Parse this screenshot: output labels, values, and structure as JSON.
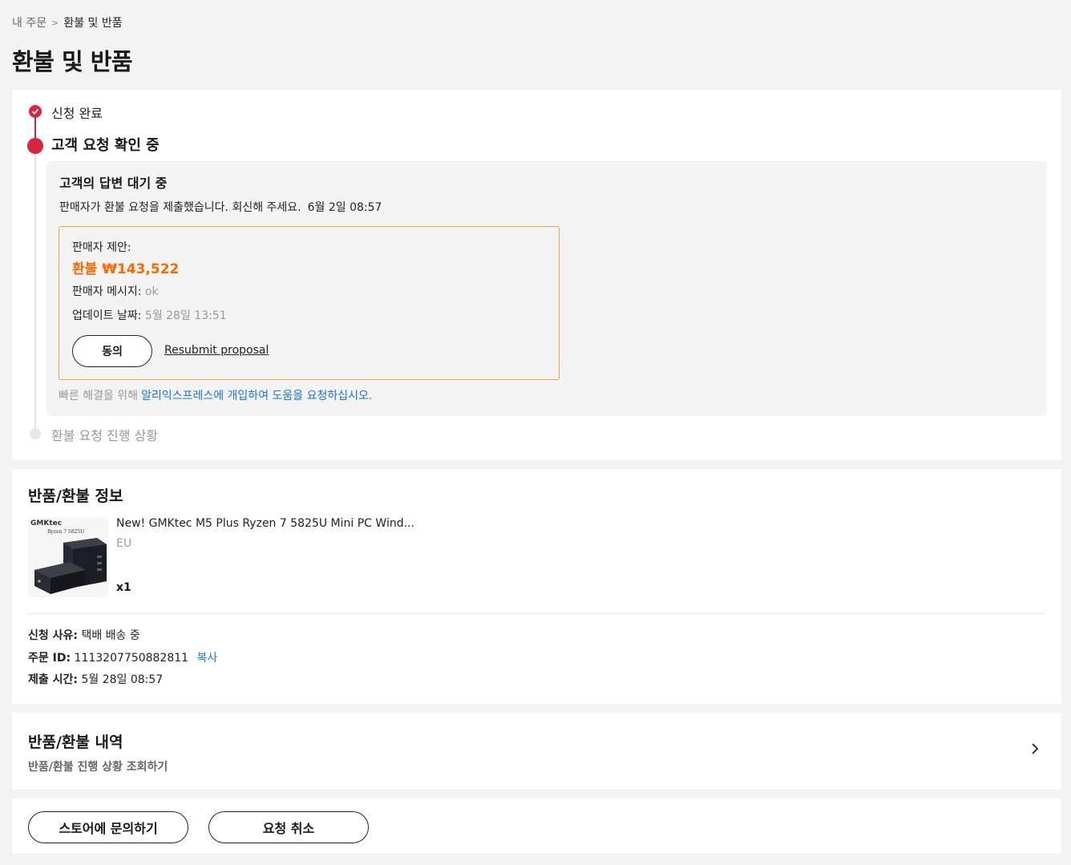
{
  "breadcrumb": {
    "parent": "내 주문",
    "separator": ">",
    "current": "환불 및 반품"
  },
  "page_title": "환불 및 반품",
  "timeline": {
    "step1": "신청 완료",
    "step2": "고객 요청 확인 중",
    "step3": "환불 요청 진행 상황"
  },
  "pending": {
    "title": "고객의 답변 대기 중",
    "message": "판매자가 환불 요청을 제출했습니다. 회신해 주세요.",
    "time": "6월 2일 08:57"
  },
  "proposal": {
    "label": "판매자 제안:",
    "amount": "환불 ₩143,522",
    "message_key": "판매자 메시지:",
    "message_value": "ok",
    "updated_key": "업데이트 날짜:",
    "updated_value": "5월 28일 13:51",
    "agree_label": "동의",
    "resubmit_label": "Resubmit proposal"
  },
  "help": {
    "prefix": "빠른 해결을 위해",
    "link": "알리익스프레스에 개입하여 도움을 요청하십시오."
  },
  "info": {
    "title": "반품/환불 정보",
    "thumb_brand": "GMKtec",
    "thumb_model": "Ryzen 7 5825U",
    "product_name": "New! GMKtec M5 Plus Ryzen 7 5825U Mini PC Wind...",
    "variant": "EU",
    "quantity": "x1",
    "reason_key": "신청 사유:",
    "reason_value": "택배 배송 중",
    "order_key": "주문 ID:",
    "order_value": "1113207750882811",
    "copy_label": "복사",
    "time_key": "제출 시간:",
    "time_value": "5월 28일 08:57"
  },
  "history": {
    "title": "반품/환불 내역",
    "subtitle": "반품/환불 진행 상황 조회하기"
  },
  "actions": {
    "contact_store": "스토어에 문의하기",
    "cancel_request": "요청 취소"
  },
  "colors": {
    "accent": "#d7263d",
    "price": "#ff6a00",
    "link": "#1a73e8",
    "proposal_border": "#f2a33a"
  }
}
